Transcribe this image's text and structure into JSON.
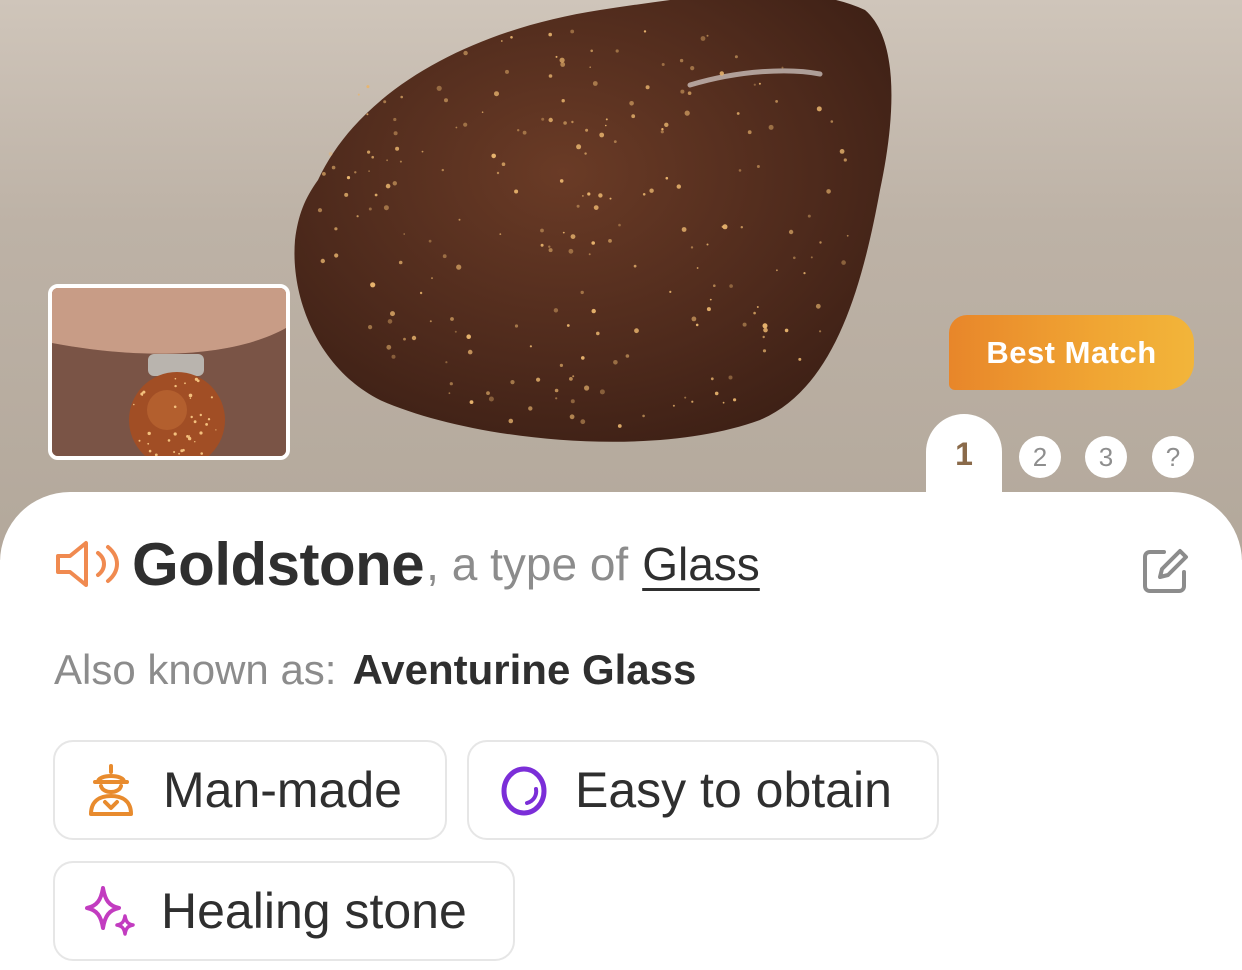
{
  "hero": {
    "badge": "Best Match",
    "pages": [
      "1",
      "2",
      "3",
      "?"
    ]
  },
  "result": {
    "name": "Goldstone",
    "type_prefix": ", a type of",
    "type_link": "Glass",
    "aka_label": "Also known as:",
    "aka_value": "Aventurine Glass"
  },
  "tags": [
    {
      "label": "Man-made",
      "icon": "man-made-icon",
      "color": "#e88b2e"
    },
    {
      "label": "Easy to obtain",
      "icon": "ring-icon",
      "color": "#7b2ed8"
    },
    {
      "label": "Healing stone",
      "icon": "sparkle-icon",
      "color": "#c23cc0"
    }
  ],
  "colors": {
    "accent": "#e8862a",
    "speaker": "#f08a50",
    "text": "#2f2f2f",
    "muted": "#8c8c8c"
  }
}
